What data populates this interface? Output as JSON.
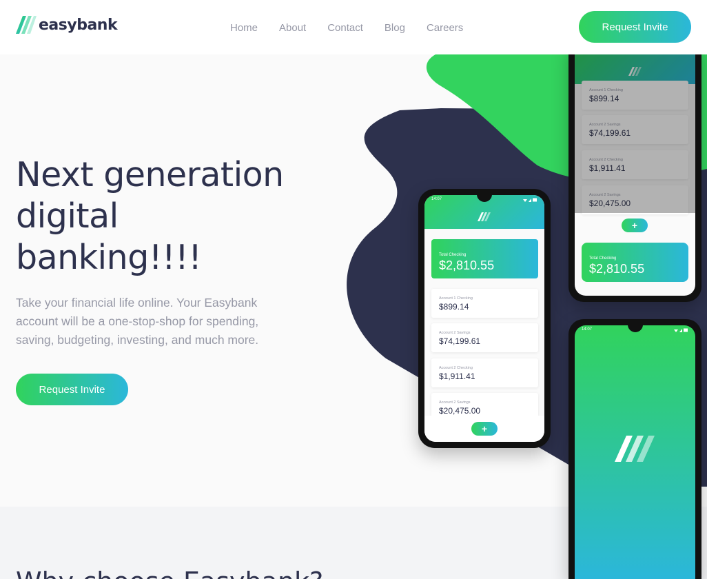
{
  "brand": {
    "name": "easybank"
  },
  "nav": {
    "items": [
      "Home",
      "About",
      "Contact",
      "Blog",
      "Careers"
    ]
  },
  "header": {
    "cta_label": "Request Invite"
  },
  "hero": {
    "title": "Next generation digital banking!!!!",
    "text": "Take your financial life online. Your Easybank account will be a one-stop-shop for spending, saving, budgeting, investing, and much more.",
    "cta_label": "Request Invite"
  },
  "phone_app": {
    "status_time": "14:07",
    "total_label": "Total Checking",
    "total_value": "$2,810.55",
    "accounts": [
      {
        "label": "Account 1 Checking",
        "value": "$899.14"
      },
      {
        "label": "Account 2 Savings",
        "value": "$74,199.61"
      },
      {
        "label": "Account 2 Checking",
        "value": "$1,911.41"
      },
      {
        "label": "Account 2 Savings",
        "value": "$20,475.00"
      }
    ],
    "add_symbol": "+"
  },
  "section_two": {
    "title": "Why choose Easybank?"
  },
  "colors": {
    "dark_blue": "#2d314d",
    "lime_green": "#31d35c",
    "bright_cyan": "#2bb7da",
    "grayish_blue": "#9698a6",
    "light_gray": "#fafafa"
  },
  "icons": [
    "logo-icon",
    "wifi-icon",
    "signal-icon",
    "battery-icon",
    "plus-icon"
  ]
}
